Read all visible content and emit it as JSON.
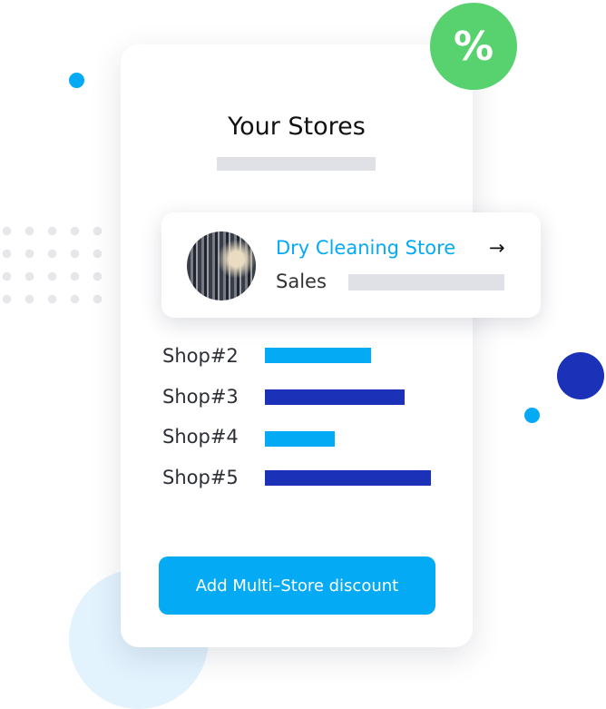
{
  "colors": {
    "primary_blue": "#05aaf5",
    "navy": "#1a31b8",
    "green": "#57d26f",
    "light_blue": "#e2f3fe"
  },
  "page_title": "Your Stores",
  "badge": {
    "symbol": "%"
  },
  "store_card": {
    "store_name": "Dry Cleaning Store",
    "arrow": "→",
    "arrow_icon": "arrow-right-icon",
    "sales_label": "Sales"
  },
  "shops": [
    {
      "label": "Shop#2",
      "relative_sales": 0.64,
      "color": "#05aaf5"
    },
    {
      "label": "Shop#3",
      "relative_sales": 0.84,
      "color": "#1a31b8"
    },
    {
      "label": "Shop#4",
      "relative_sales": 0.42,
      "color": "#05aaf5"
    },
    {
      "label": "Shop#5",
      "relative_sales": 1.0,
      "color": "#1a31b8"
    }
  ],
  "actions": {
    "add_discount_label": "Add Multi–Store discount"
  }
}
